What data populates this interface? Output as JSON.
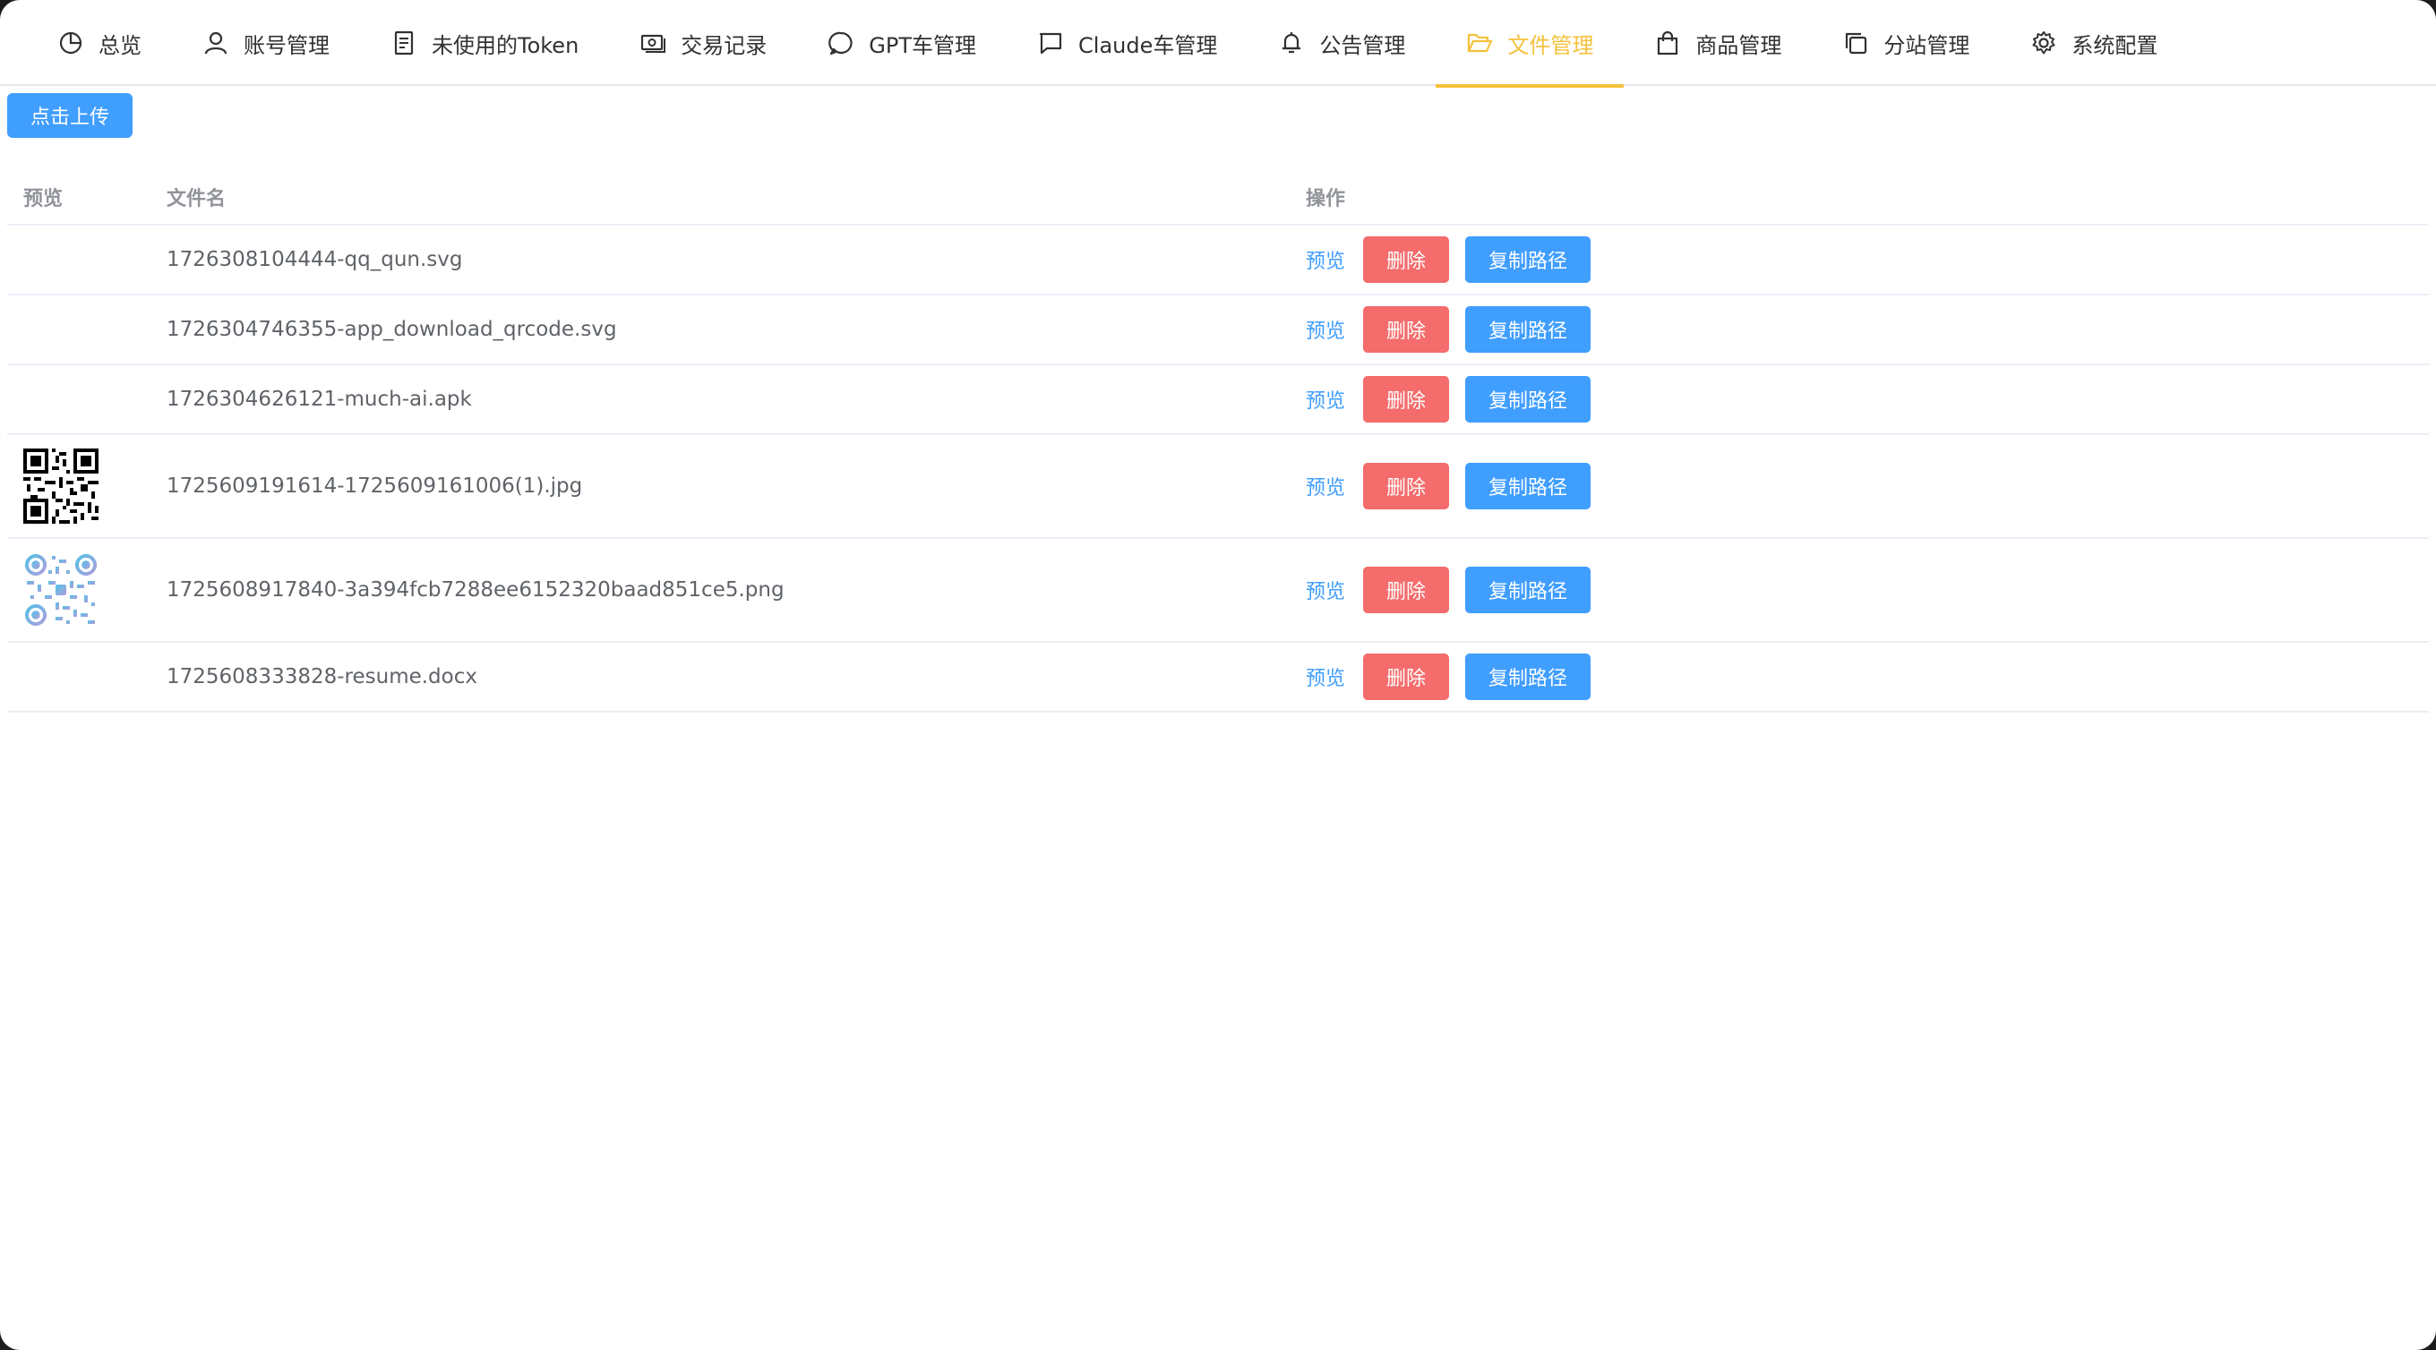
{
  "nav": {
    "items": [
      {
        "label": "总览",
        "icon": "pie-chart-icon"
      },
      {
        "label": "账号管理",
        "icon": "user-icon"
      },
      {
        "label": "未使用的Token",
        "icon": "document-icon"
      },
      {
        "label": "交易记录",
        "icon": "money-icon"
      },
      {
        "label": "GPT车管理",
        "icon": "chat-round-icon"
      },
      {
        "label": "Claude车管理",
        "icon": "chat-square-icon"
      },
      {
        "label": "公告管理",
        "icon": "bell-icon"
      },
      {
        "label": "文件管理",
        "icon": "folder-open-icon",
        "active": true
      },
      {
        "label": "商品管理",
        "icon": "shopping-bag-icon"
      },
      {
        "label": "分站管理",
        "icon": "copy-icon"
      },
      {
        "label": "系统配置",
        "icon": "gear-icon"
      }
    ]
  },
  "upload": {
    "label": "点击上传"
  },
  "table": {
    "headers": {
      "preview": "预览",
      "filename": "文件名",
      "ops": "操作"
    },
    "rows": [
      {
        "filename": "1726308104444-qq_qun.svg",
        "thumb": "none",
        "preview": "预览",
        "delete": "删除",
        "copy": "复制路径"
      },
      {
        "filename": "1726304746355-app_download_qrcode.svg",
        "thumb": "none",
        "preview": "预览",
        "delete": "删除",
        "copy": "复制路径"
      },
      {
        "filename": "1726304626121-much-ai.apk",
        "thumb": "none",
        "preview": "预览",
        "delete": "删除",
        "copy": "复制路径"
      },
      {
        "filename": "1725609191614-1725609161006(1).jpg",
        "thumb": "qr-black",
        "preview": "预览",
        "delete": "删除",
        "copy": "复制路径"
      },
      {
        "filename": "1725608917840-3a394fcb7288ee6152320baad851ce5.png",
        "thumb": "qr-color",
        "preview": "预览",
        "delete": "删除",
        "copy": "复制路径"
      },
      {
        "filename": "1725608333828-resume.docx",
        "thumb": "none",
        "preview": "预览",
        "delete": "删除",
        "copy": "复制路径"
      }
    ]
  },
  "colors": {
    "accent": "#f5c13b",
    "primary": "#409eff",
    "danger": "#f56c6c"
  }
}
